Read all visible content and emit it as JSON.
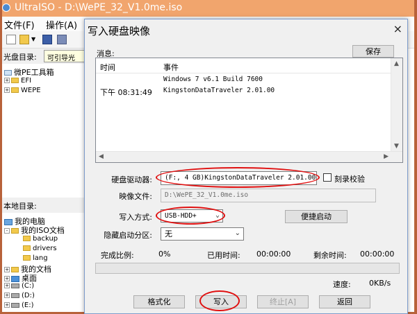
{
  "background_app": {
    "title": "UltraISO - D:\\WePE_32_V1.0me.iso",
    "menu": [
      "文件(F)",
      "操作(A)"
    ],
    "iso_label": "光盘目录:",
    "iso_value": "可引导光",
    "iso_tree": {
      "root": "微PE工具箱",
      "items": [
        "EFI",
        "WEPE"
      ]
    },
    "local_label": "本地目录:",
    "local_tree": {
      "my_computer": "我的电脑",
      "iso_docs": "我的ISO文档",
      "subfolders": [
        "backup",
        "drivers",
        "lang"
      ],
      "my_docs": "我的文档",
      "desktop": "桌面",
      "drives": [
        "(C:)",
        "(D:)",
        "(E:)"
      ]
    }
  },
  "dialog": {
    "title": "写入硬盘映像",
    "close": "×",
    "messages_label": "消息:",
    "save_button": "保存",
    "log": {
      "headers": {
        "time": "时间",
        "event": "事件"
      },
      "rows": [
        {
          "time": "",
          "event": "Windows 7 v6.1 Build 7600"
        },
        {
          "time": "下午 08:31:49",
          "event": "KingstonDataTraveler 2.01.00"
        }
      ]
    },
    "drive_label": "硬盘驱动器:",
    "drive_value": "(F:, 4 GB)KingstonDataTraveler 2.01.00",
    "verify_label": "刻录校验",
    "verify_checked": false,
    "image_file_label": "映像文件:",
    "image_file_value": "D:\\WePE_32_V1.0me.iso",
    "write_method_label": "写入方式:",
    "write_method_value": "USB-HDD+",
    "quick_boot_button": "便捷启动",
    "hidden_partition_label": "隐藏启动分区:",
    "hidden_partition_value": "无",
    "status": {
      "completed_label": "完成比例:",
      "completed_value": "0%",
      "elapsed_label": "已用时间:",
      "elapsed_value": "00:00:00",
      "remaining_label": "剩余时间:",
      "remaining_value": "00:00:00",
      "speed_label": "速度:",
      "speed_value": "0KB/s",
      "progress_fraction": 0
    },
    "buttons": {
      "format": "格式化",
      "write": "写入",
      "stop": "终止[A]",
      "back": "返回"
    }
  },
  "colors": {
    "window_frame": "#e9a969",
    "dialog_border": "#7d9ccc",
    "highlight_ring": "#e01010",
    "progress_fill": "#06b025"
  }
}
